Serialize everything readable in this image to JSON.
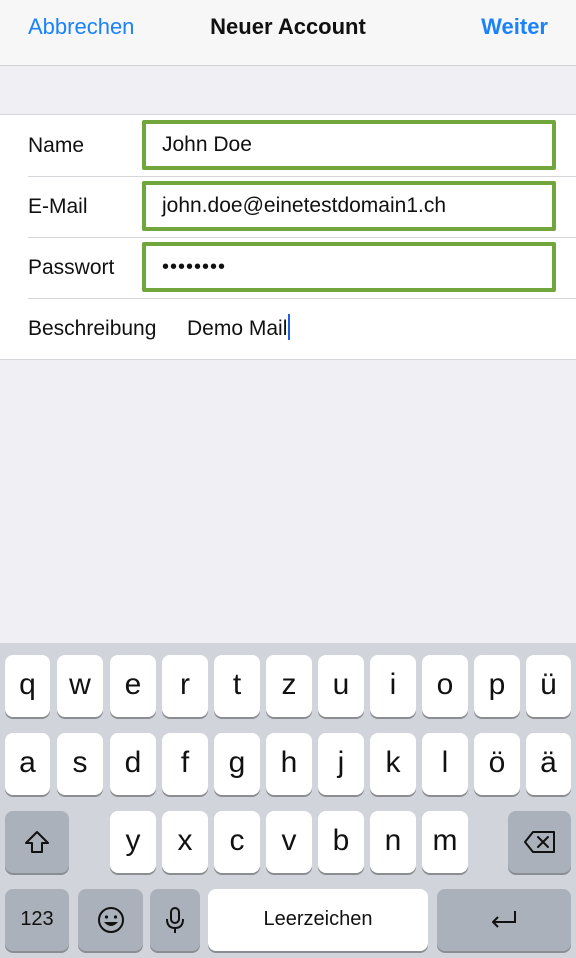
{
  "navbar": {
    "cancel_label": "Abbrechen",
    "title": "Neuer Account",
    "next_label": "Weiter"
  },
  "form": {
    "name": {
      "label": "Name",
      "value": "John Doe"
    },
    "email": {
      "label": "E-Mail",
      "value": "john.doe@einetestdomain1.ch"
    },
    "password": {
      "label": "Passwort",
      "value": "••••••••"
    },
    "description": {
      "label": "Beschreibung",
      "value": "Demo Mail"
    }
  },
  "keyboard": {
    "row1": [
      "q",
      "w",
      "e",
      "r",
      "t",
      "z",
      "u",
      "i",
      "o",
      "p",
      "ü"
    ],
    "row2": [
      "a",
      "s",
      "d",
      "f",
      "g",
      "h",
      "j",
      "k",
      "l",
      "ö",
      "ä"
    ],
    "row3": [
      "y",
      "x",
      "c",
      "v",
      "b",
      "n",
      "m"
    ],
    "numbers_label": "123",
    "space_label": "Leerzeichen",
    "icons": {
      "shift": "shift-icon",
      "backspace": "backspace-icon",
      "emoji": "emoji-icon",
      "mic": "microphone-icon",
      "return": "return-icon"
    }
  },
  "colors": {
    "accent": "#1a82fb",
    "highlight": "#70a63c",
    "keyboard_bg": "#d1d4da"
  }
}
